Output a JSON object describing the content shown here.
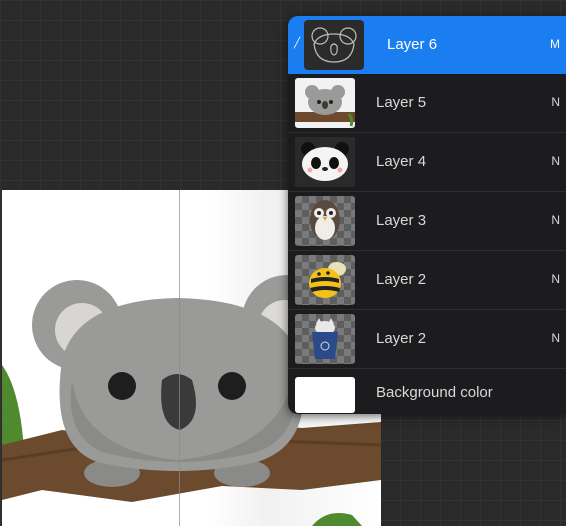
{
  "layers": [
    {
      "name": "Layer 6",
      "mode": "M",
      "selected": true,
      "thumb": "koala-sketch-icon"
    },
    {
      "name": "Layer 5",
      "mode": "N",
      "selected": false,
      "thumb": "koala-icon"
    },
    {
      "name": "Layer 4",
      "mode": "N",
      "selected": false,
      "thumb": "panda-icon"
    },
    {
      "name": "Layer 3",
      "mode": "N",
      "selected": false,
      "thumb": "owl-icon"
    },
    {
      "name": "Layer 2",
      "mode": "N",
      "selected": false,
      "thumb": "bee-icon"
    },
    {
      "name": "Layer 2",
      "mode": "N",
      "selected": false,
      "thumb": "cat-cup-icon"
    }
  ],
  "background": {
    "label": "Background color",
    "color": "#ffffff"
  },
  "colors": {
    "selected": "#1a7df0",
    "panel": "#1c1c1e",
    "koala": "#9a9a98",
    "branch": "#6b4a2e",
    "leaf": "#4f8a2e"
  }
}
